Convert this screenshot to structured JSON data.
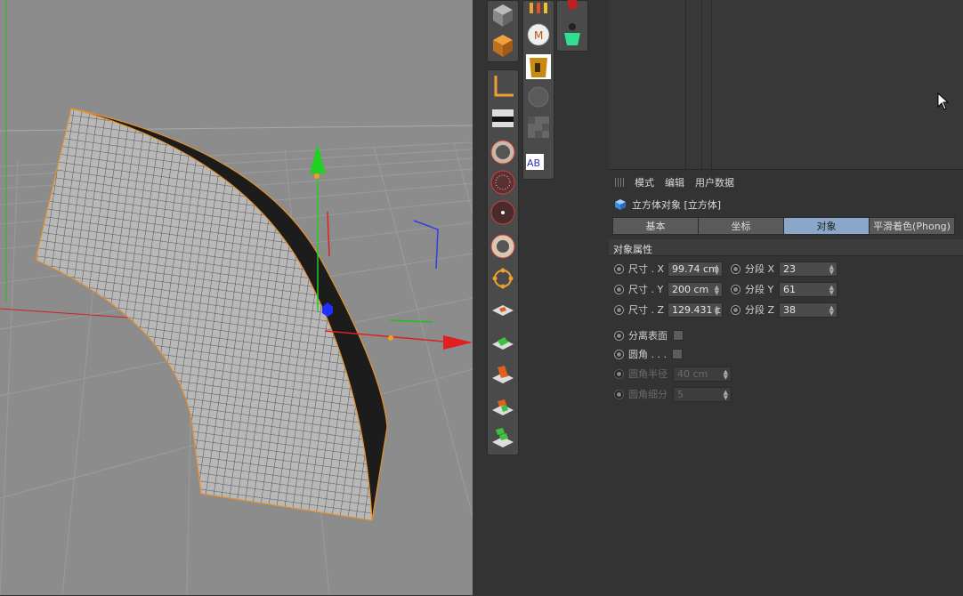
{
  "attributes": {
    "menu": [
      "模式",
      "编辑",
      "用户数据"
    ],
    "object_title": "立方体对象 [立方体]",
    "tabs": [
      {
        "label": "基本",
        "active": false
      },
      {
        "label": "坐标",
        "active": false
      },
      {
        "label": "对象",
        "active": true
      },
      {
        "label": "平滑着色(Phong)",
        "active": false
      }
    ],
    "section_title": "对象属性",
    "size_x_label": "尺寸 . X",
    "size_x_value": "99.74 cm",
    "size_y_label": "尺寸 . Y",
    "size_y_value": "200 cm",
    "size_z_label": "尺寸 . Z",
    "size_z_value": "129.431 c",
    "seg_x_label": "分段 X",
    "seg_x_value": "23",
    "seg_y_label": "分段 Y",
    "seg_y_value": "61",
    "seg_z_label": "分段 Z",
    "seg_z_value": "38",
    "separate_label": "分离表面",
    "fillet_label": "圆角 . . .",
    "fillet_radius_label": "圆角半径",
    "fillet_radius_value": "40 cm",
    "fillet_sub_label": "圆角细分",
    "fillet_sub_value": "5"
  },
  "colors": {
    "viewport_bg": "#8c8c8c",
    "axis_x": "#e02020",
    "axis_y": "#20c020",
    "axis_z": "#2030e0",
    "selection_outline": "#e8902a",
    "active_tab": "#8aa6c8"
  },
  "icons": {
    "toolbar": [
      "cube-icon",
      "cube-orange-icon",
      "axis-icon",
      "gradient-icon",
      "radial-spline-icon",
      "dark-radial-icon",
      "dot-radial-icon",
      "star-radial-icon",
      "circle-points-icon",
      "fracture-orange-icon",
      "fracture-green-icon",
      "fracture-stack-icon",
      "fracture-mixed-icon",
      "fracture-green-stack-icon"
    ],
    "extra": [
      "figures-icon",
      "gear-m-icon",
      "red-brush-icon",
      "person-green-icon",
      "gold-box-icon",
      "ghost-sphere-icon",
      "checker-icon",
      "ab-text-icon"
    ]
  }
}
